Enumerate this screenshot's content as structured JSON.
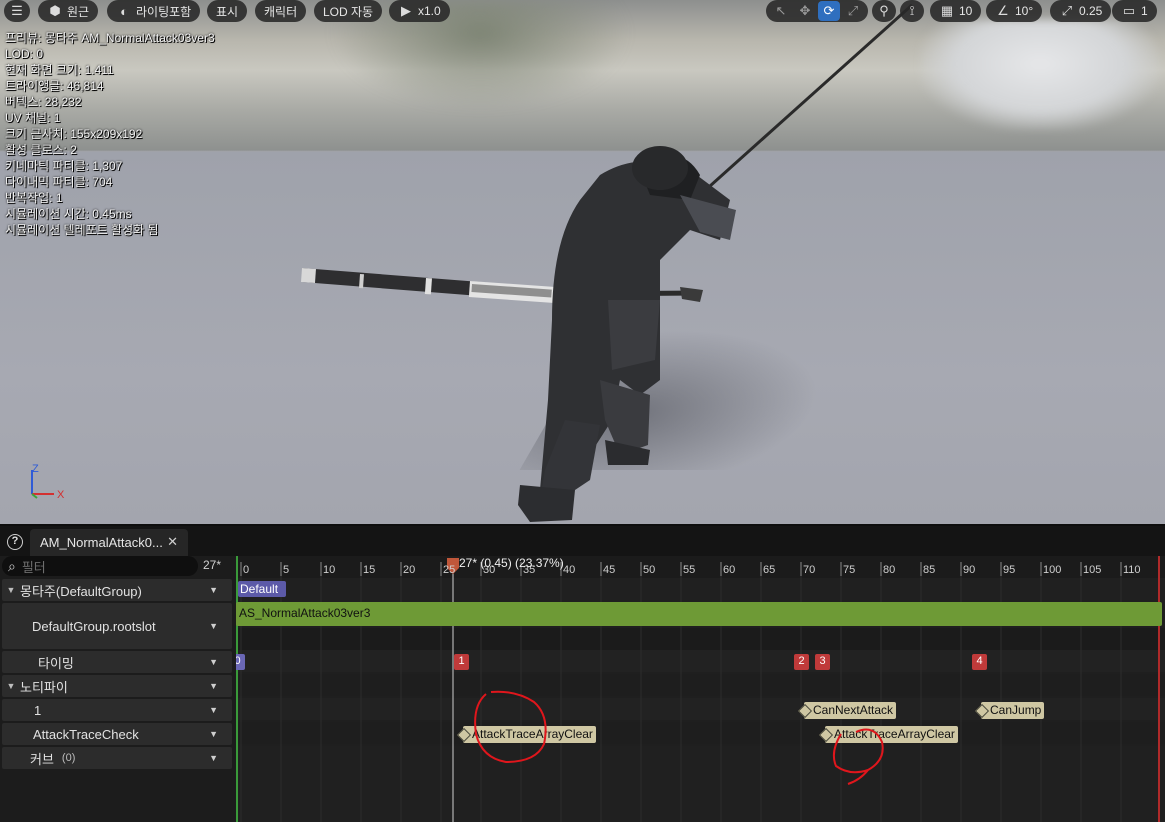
{
  "toolbar": {
    "perspective_label": "원근",
    "lighting_label": "라이팅포함",
    "show_label": "표시",
    "character_label": "캐릭터",
    "lod_label": "LOD 자동",
    "play_speed_label": "x1.0",
    "grid_snap_value": "10",
    "rotation_snap_value": "10°",
    "scale_snap_value": "0.25",
    "camera_speed_value": "1"
  },
  "stats": [
    "프리뷰: 몽타주 AM_NormalAttack03ver3",
    "LOD: 0",
    "현재 화면 크기: 1.411",
    "트라이앵글: 46,814",
    "버텍스: 28,232",
    "UV 채널: 1",
    "크기 근사치: 155x209x192",
    "활성 클로스: 2",
    "키네마틱 파티클: 1,307",
    "다이내믹 파티클: 704",
    "반복작업: 1",
    "시뮬레이션 시간: 0.45ms",
    "시뮬레이션 텔레포트 활성화 됨"
  ],
  "axis": {
    "z": "Z",
    "x": "X"
  },
  "panel": {
    "tab_label": "AM_NormalAttack0...",
    "filter_placeholder": "필터",
    "frame_count": "27*",
    "tracks": {
      "montage_group": "몽타주(DefaultGroup)",
      "slot": "DefaultGroup.rootslot",
      "timing": "타이밍",
      "notifies": "노티파이",
      "notify_track_1": "1",
      "notify_track_2": "AttackTraceCheck",
      "curves": "커브",
      "curves_count": "(0)"
    }
  },
  "timeline": {
    "ticks": [
      "0",
      "5",
      "10",
      "15",
      "20",
      "25",
      "30",
      "35",
      "40",
      "45",
      "50",
      "55",
      "60",
      "65",
      "70",
      "75",
      "80",
      "85",
      "90",
      "95",
      "100",
      "105",
      "110"
    ],
    "scrub_label": "27* (0.45) (23.37%)",
    "section_name": "Default",
    "montage_anim": "AS_NormalAttack03ver3",
    "branch_points": [
      "0",
      "1",
      "2",
      "3",
      "4"
    ],
    "notifies": {
      "can_next_attack": "CanNextAttack",
      "can_jump": "CanJump",
      "trace_clear_1": "AttackTraceArrayClear",
      "trace_clear_2": "AttackTraceArrayClear"
    }
  },
  "colors": {
    "accent_blue": "#2f6fbf",
    "section_purple": "#5c5aa8",
    "montage_green": "#6e9a36",
    "branch_red": "#c03a3a",
    "notify_tan": "#cfc7a3",
    "annotation_red": "#e0161c"
  }
}
